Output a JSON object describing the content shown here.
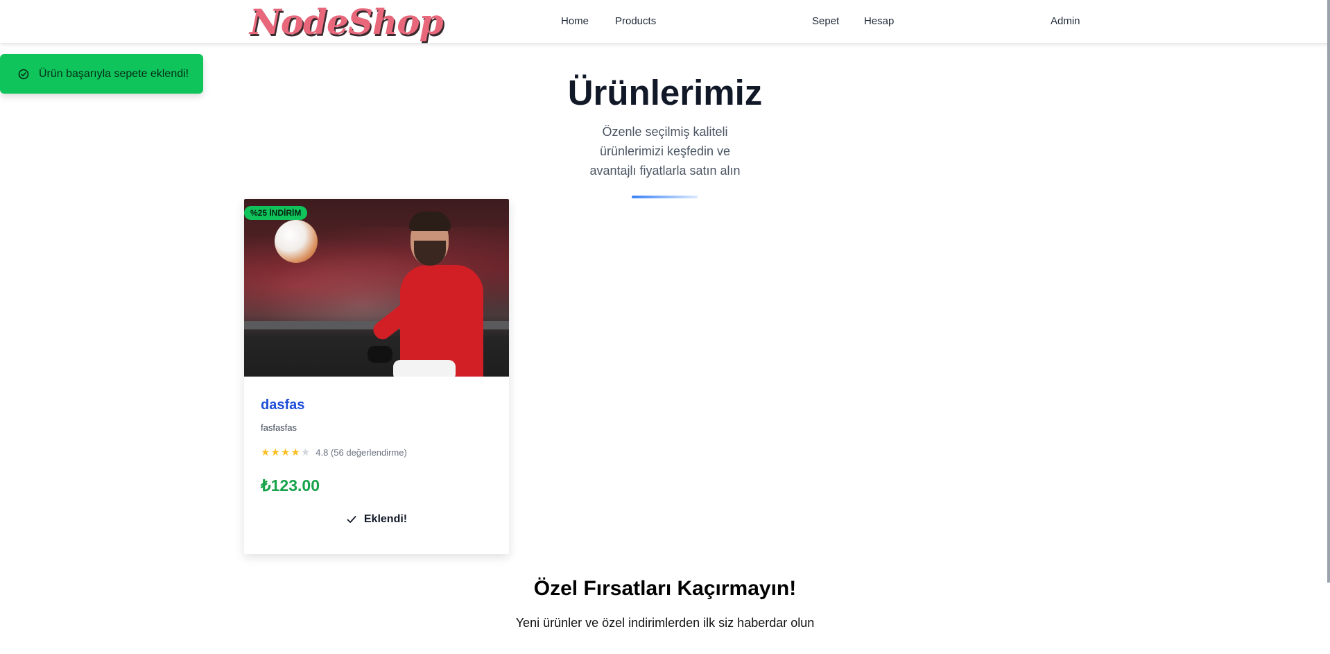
{
  "navbar": {
    "logo": "NodeShop",
    "links": [
      "Home",
      "Products",
      "Sepet",
      "Hesap",
      "Admin"
    ]
  },
  "toast": {
    "icon": "check-circle-icon",
    "message": "Ürün başarıyla sepete eklendi!",
    "color": "#10c45c"
  },
  "hero": {
    "title": "Ürünlerimiz",
    "subtitle": "Özenle seçilmiş kaliteli ürünlerimizi keşfedin ve avantajlı fiyatlarla satın alın"
  },
  "products": [
    {
      "badge": "%25 İNDİRİM",
      "name": "dasfas",
      "description": "fasfasfas",
      "rating_stars": 4,
      "rating_max": 5,
      "rating_text": "4.8 (56 değerlendirme)",
      "price": "₺123.00",
      "button_icon": "check-icon",
      "button_label": "Eklendi!"
    }
  ],
  "promo": {
    "title": "Özel Fırsatları Kaçırmayın!",
    "subtitle": "Yeni ürünler ve özel indirimlerden ilk siz haberdar olun"
  },
  "colors": {
    "accent_green": "#10c45c",
    "price_green": "#16a34a",
    "product_name_blue": "#1d4ed8",
    "star_yellow": "#fbbf24"
  }
}
